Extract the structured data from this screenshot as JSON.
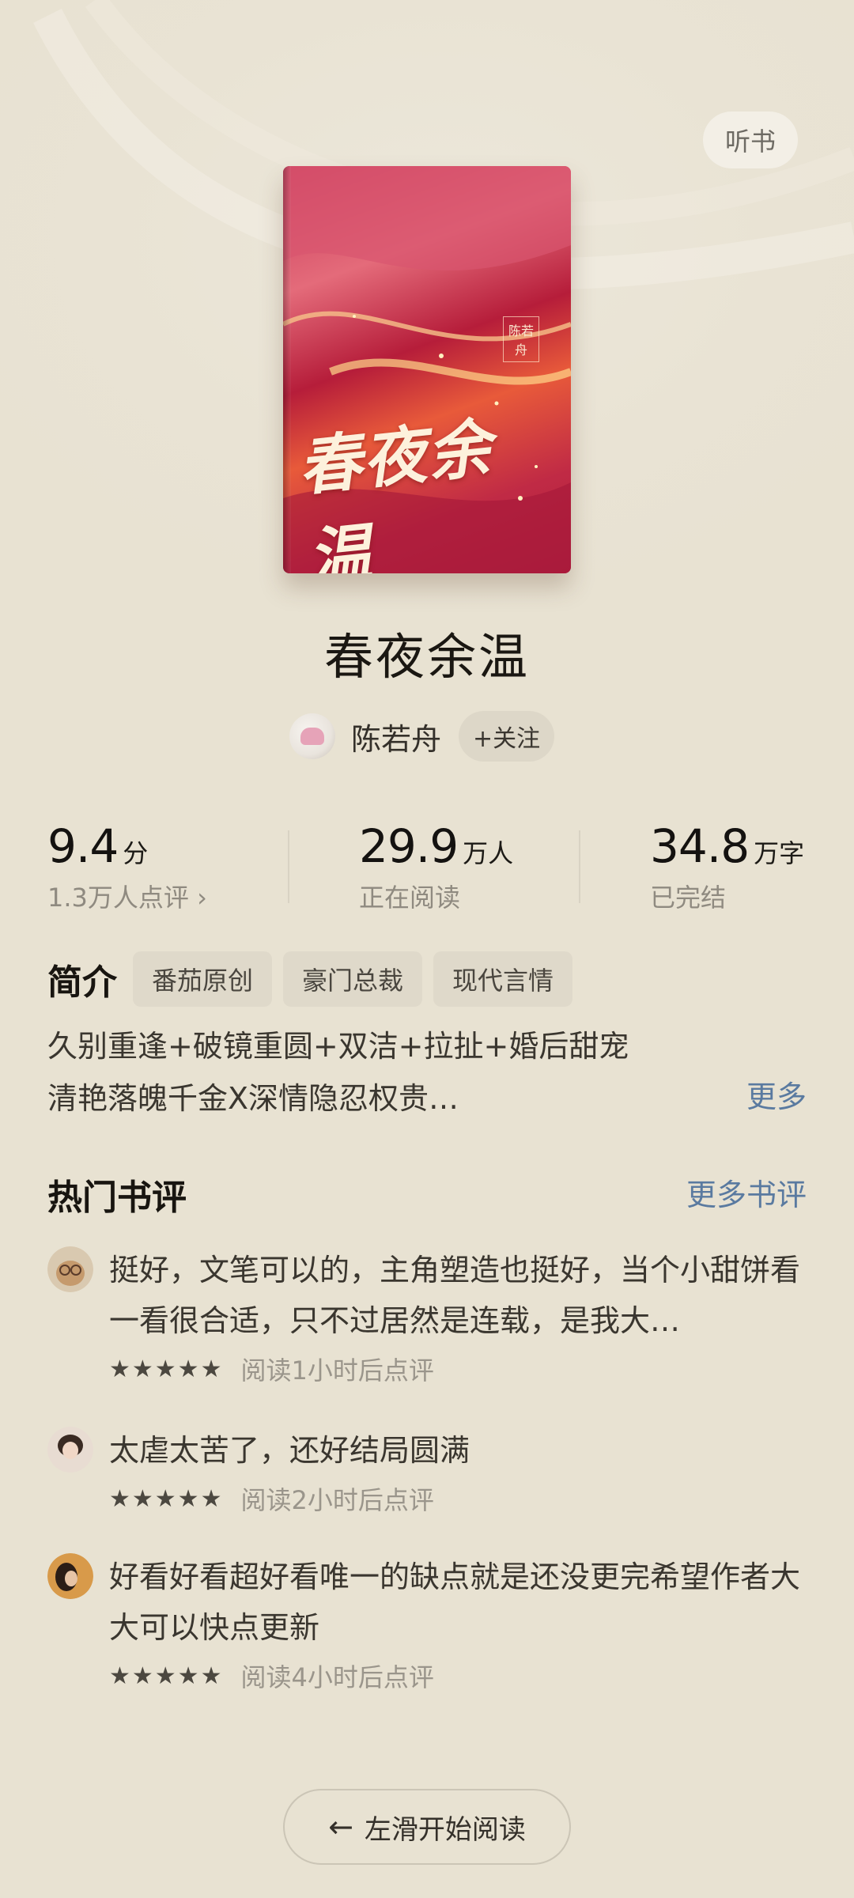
{
  "header": {
    "listen_label": "听书"
  },
  "book": {
    "cover_title": "春夜余温",
    "cover_author": "陈若舟",
    "title": "春夜余温",
    "author": "陈若舟",
    "follow_label": "+关注"
  },
  "stats": [
    {
      "value": "9.4",
      "unit": "分",
      "sub": "1.3万人点评 ›"
    },
    {
      "value": "29.9",
      "unit": "万人",
      "sub": "正在阅读"
    },
    {
      "value": "34.8",
      "unit": "万字",
      "sub": "已完结"
    }
  ],
  "intro": {
    "label": "简介",
    "tags": [
      "番茄原创",
      "豪门总裁",
      "现代言情"
    ],
    "line1": "久别重逢+破镜重圆+双洁+拉扯+婚后甜宠",
    "line2": "清艳落魄千金X深情隐忍权贵…",
    "more_label": "更多"
  },
  "reviews_section": {
    "title": "热门书评",
    "more_label": "更多书评",
    "reviews": [
      {
        "text": "挺好，文笔可以的，主角塑造也挺好，当个小甜饼看一看很合适，只不过居然是连载，是我大…",
        "stars": "★★★★★",
        "meta": "阅读1小时后点评"
      },
      {
        "text": "太虐太苦了，还好结局圆满",
        "stars": "★★★★★",
        "meta": "阅读2小时后点评"
      },
      {
        "text": "好看好看超好看唯一的缺点就是还没更完希望作者大大可以快点更新",
        "stars": "★★★★★",
        "meta": "阅读4小时后点评"
      }
    ]
  },
  "footer": {
    "start_label": "左滑开始阅读",
    "arrow": "←"
  }
}
